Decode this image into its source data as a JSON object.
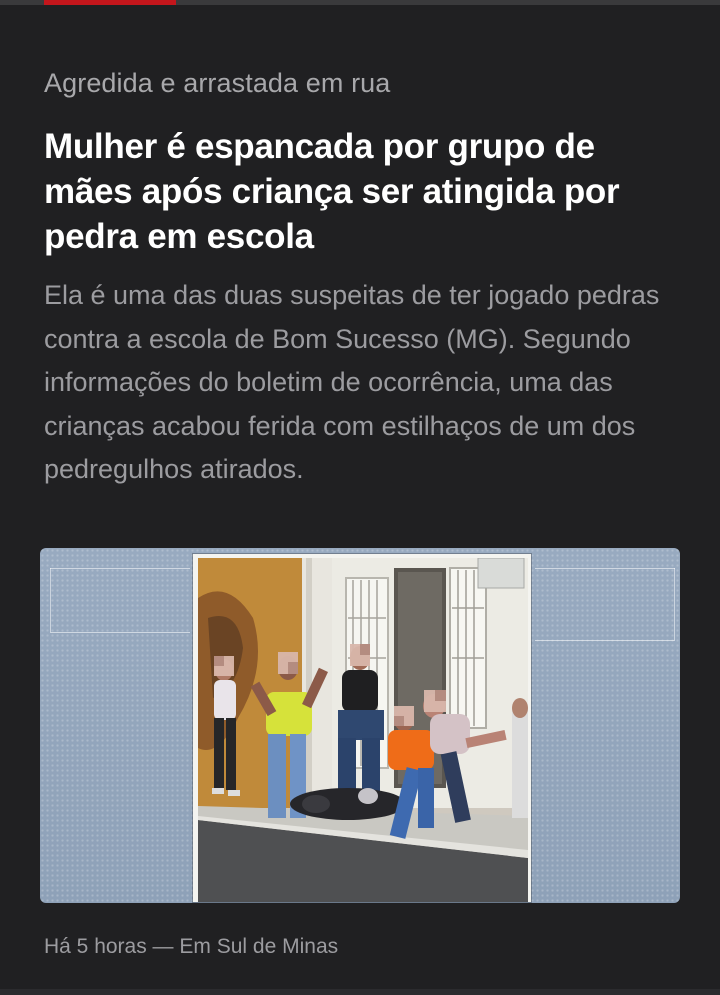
{
  "colors": {
    "accent": "#c3161c",
    "background": "#202022",
    "headline": "#ffffff",
    "muted_text": "#9c9ca0"
  },
  "article": {
    "kicker": "Agredida e arrastada em rua",
    "headline": "Mulher é espancada por grupo de mães após criança ser atingida por pedra em escola",
    "summary": "Ela é uma das duas suspeitas de ter jogado pedras contra a escola de Bom Sucesso (MG). Segundo informações do boletim de ocorrência, uma das crianças acabou ferida com estilhaços de um dos pedregulhos atirados.",
    "image": {
      "kind": "video-still",
      "subject": "street-fight-in-front-of-building"
    },
    "meta": "Há 5 horas — Em Sul de Minas"
  }
}
